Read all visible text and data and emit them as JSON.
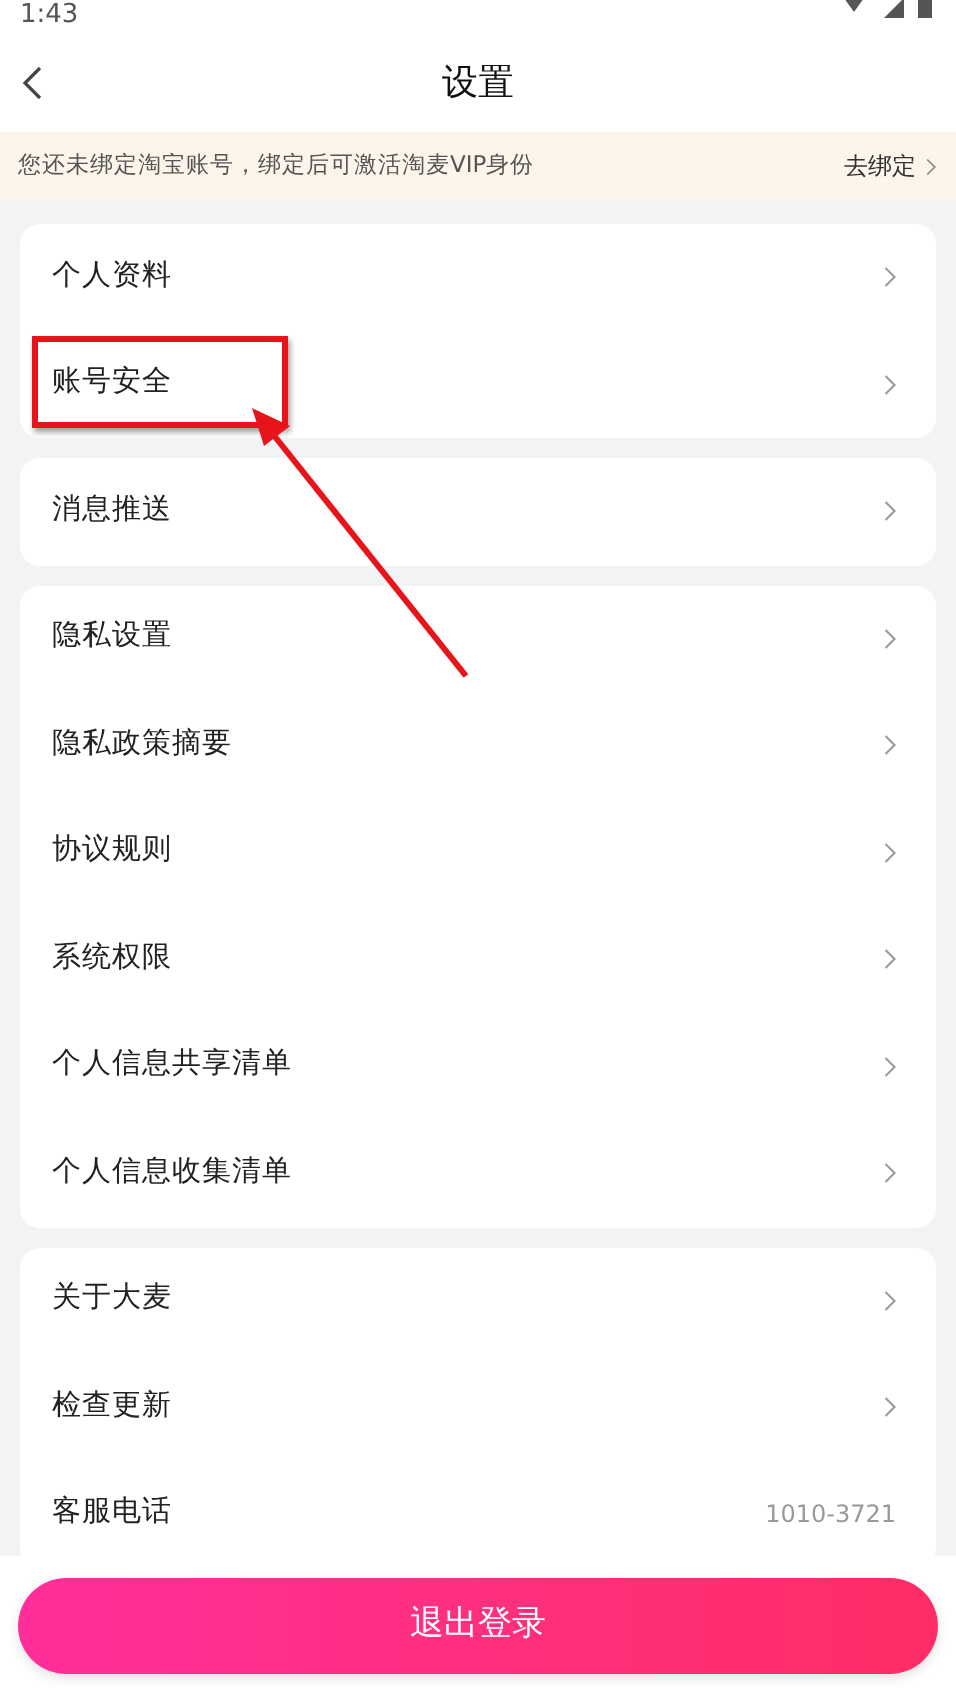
{
  "status_bar": {
    "time": "1:43"
  },
  "header": {
    "title": "设置"
  },
  "banner": {
    "text": "您还未绑定淘宝账号，绑定后可激活淘麦VIP身份",
    "action": "去绑定"
  },
  "groups": [
    {
      "items": [
        {
          "label": "个人资料",
          "highlighted": false
        },
        {
          "label": "账号安全",
          "highlighted": true
        }
      ]
    },
    {
      "items": [
        {
          "label": "消息推送",
          "highlighted": false
        }
      ]
    },
    {
      "items": [
        {
          "label": "隐私设置",
          "highlighted": false
        },
        {
          "label": "隐私政策摘要",
          "highlighted": false
        },
        {
          "label": "协议规则",
          "highlighted": false
        },
        {
          "label": "系统权限",
          "highlighted": false
        },
        {
          "label": "个人信息共享清单",
          "highlighted": false
        },
        {
          "label": "个人信息收集清单",
          "highlighted": false
        }
      ]
    },
    {
      "items": [
        {
          "label": "关于大麦",
          "highlighted": false
        },
        {
          "label": "检查更新",
          "highlighted": false
        },
        {
          "label": "客服电话",
          "value": "1010-3721",
          "highlighted": false
        }
      ]
    }
  ],
  "logout_button": "退出登录"
}
